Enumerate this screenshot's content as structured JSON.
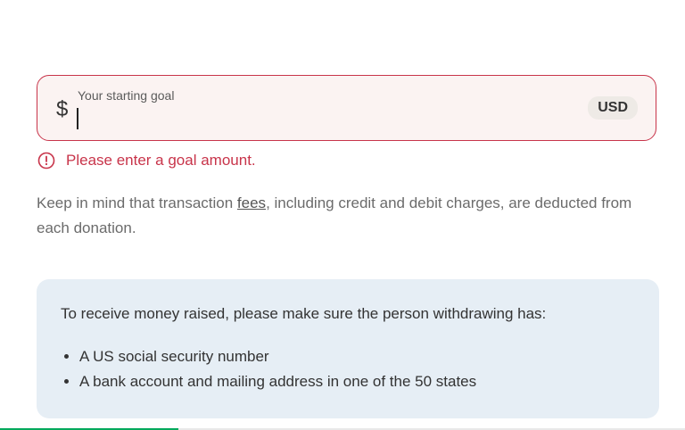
{
  "goal": {
    "label": "Your starting goal",
    "currency_symbol": "$",
    "value": "",
    "currency_code": "USD"
  },
  "error": {
    "message": "Please enter a goal amount.",
    "color": "#c8344a"
  },
  "fees_note": {
    "before": "Keep in mind that transaction ",
    "link_text": "fees",
    "after": ", including credit and debit charges, are deducted from each donation."
  },
  "info_box": {
    "title": "To receive money raised, please make sure the person withdrawing has:",
    "requirements": [
      "A US social security number",
      "A bank account and mailing address in one of the 50 states"
    ]
  },
  "progress": {
    "fraction": 0.26,
    "color": "#02a95c"
  }
}
